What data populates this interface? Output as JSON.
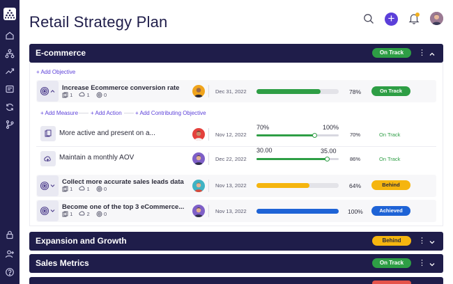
{
  "page": {
    "title": "Retail Strategy Plan"
  },
  "header": {
    "add_label": "+"
  },
  "colors": {
    "navy": "#1f1d4a",
    "accent": "#5b3fd9",
    "green": "#2e9e45",
    "yellow": "#f5b50f",
    "blue": "#1e63d6",
    "red": "#e5534b"
  },
  "sidebar": {
    "icons": [
      "apps-logo-icon",
      "home-icon",
      "hierarchy-icon",
      "trend-up-icon",
      "inbox-icon",
      "refresh-icon",
      "branch-icon",
      "lock-icon",
      "user-add-icon",
      "help-icon"
    ]
  },
  "sections": [
    {
      "title": "E-commerce",
      "status": "On Track"
    },
    {
      "title": "Expansion and Growth",
      "status": "Behind"
    },
    {
      "title": "Sales Metrics",
      "status": "On Track"
    }
  ],
  "ecommerce": {
    "add_objective": "+ Add Objective",
    "objectives": [
      {
        "title": "Increase Ecommerce conversion rate",
        "counts": [
          "1",
          "1",
          "0"
        ],
        "date": "Dec 31, 2022",
        "progress": 0.78,
        "percent": "78%",
        "status": "On Track"
      },
      {
        "title": "Collect more accurate sales leads data",
        "counts": [
          "1",
          "1",
          "0"
        ],
        "date": "Nov 13, 2022",
        "progress": 0.64,
        "percent": "64%",
        "status": "Behind"
      },
      {
        "title": "Become one of the top 3 eCommerce...",
        "counts": [
          "1",
          "2",
          "0"
        ],
        "date": "Nov 13, 2022",
        "progress": 1.0,
        "percent": "100%",
        "status": "Achieved"
      }
    ],
    "add_measure": "+ Add Measure",
    "add_action": "+ Add Action",
    "add_contributing": "+ Add Contributing Objective",
    "measures": [
      {
        "title": "More active and present on a...",
        "date": "Nov 12, 2022",
        "current": "70%",
        "target": "100%",
        "progress": 0.7,
        "percent": "70%",
        "status": "On Track"
      },
      {
        "title": "Maintain a monthly AOV",
        "date": "Dec 22, 2022",
        "current": "30.00",
        "target": "35.00",
        "progress": 0.86,
        "percent": "86%",
        "status": "On Track"
      }
    ]
  }
}
